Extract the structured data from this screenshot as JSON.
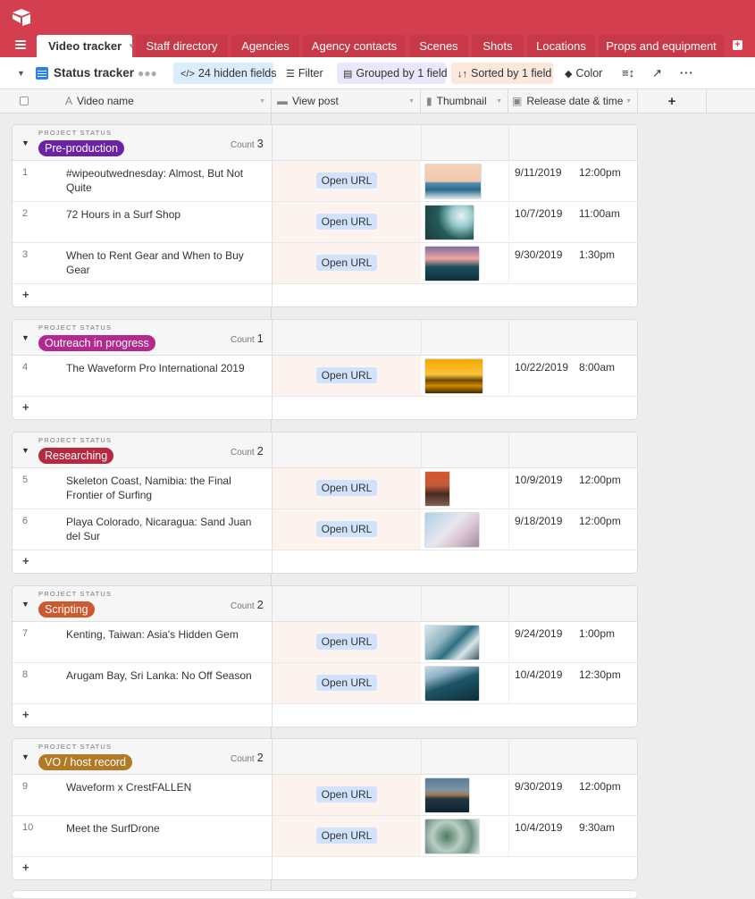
{
  "tabs": [
    {
      "label": "Video tracker",
      "active": true
    },
    {
      "label": "Staff directory"
    },
    {
      "label": "Agencies"
    },
    {
      "label": "Agency contacts"
    },
    {
      "label": "Scenes"
    },
    {
      "label": "Shots"
    },
    {
      "label": "Locations"
    },
    {
      "label": "Props and equipment"
    }
  ],
  "toolbar": {
    "view_name": "Status tracker",
    "hidden_fields": "24 hidden fields",
    "filter": "Filter",
    "grouped": "Grouped by 1 field",
    "sorted": "Sorted by 1 field",
    "color": "Color"
  },
  "columns": {
    "video_name": "Video name",
    "view_post": "View post",
    "thumbnail": "Thumbnail",
    "release": "Release date & time",
    "add": "+"
  },
  "group_label": "PROJECT STATUS",
  "count_label": "Count",
  "open_url_label": "Open URL",
  "groups": [
    {
      "status": "Pre-production",
      "color": "#6b21a8",
      "count": "3",
      "rows": [
        {
          "num": "1",
          "name": "#wipeoutwednesday: Almost, But Not Quite",
          "date": "9/11/2019",
          "time": "12:00pm",
          "thumb": "linear-gradient(180deg,#f6d2b8 0%,#f0c7ad 50%,#4f8fb0 55%,#2c6a8c 75%,#d7e2e8 100%)",
          "tw": 64
        },
        {
          "num": "2",
          "name": "72 Hours in a Surf Shop",
          "date": "10/7/2019",
          "time": "11:00am",
          "thumb": "radial-gradient(circle at 75% 30%,#e8f1f5 0%,#9cc 25%,#245a5a 55%,#1c3c3a 100%)",
          "tw": 56
        },
        {
          "num": "3",
          "name": "When to Rent Gear and When to Buy Gear",
          "date": "9/30/2019",
          "time": "1:30pm",
          "thumb": "linear-gradient(180deg,#7f6da0 0%,#f0a5a0 35%,#1b4f5e 60%,#0e2e36 100%)",
          "tw": 62
        }
      ]
    },
    {
      "status": "Outreach in progress",
      "color": "#b5298e",
      "count": "1",
      "rows": [
        {
          "num": "4",
          "name": "The Waveform Pro International 2019",
          "date": "10/22/2019",
          "time": "8:00am",
          "thumb": "linear-gradient(180deg,#f6a800 0%,#f9c23a 45%,#6a4a0a 62%,#d38a00 78%,#3a2a05 100%)",
          "tw": 66
        }
      ]
    },
    {
      "status": "Researching",
      "color": "#b7293f",
      "count": "2",
      "rows": [
        {
          "num": "5",
          "name": "Skeleton Coast, Namibia: the Final Frontier of Surfing",
          "date": "10/9/2019",
          "time": "12:00pm",
          "thumb": "linear-gradient(180deg,#d5582a 0%,#c35a3a 40%,#4a2a20 65%,#806050 100%)",
          "tw": 29
        },
        {
          "num": "6",
          "name": "Playa Colorado, Nicaragua: Sand Juan del Sur",
          "date": "9/18/2019",
          "time": "12:00pm",
          "thumb": "linear-gradient(135deg,#a9d3e4 0%,#e9e6ee 45%,#d7c1cf 70%,#9f8aa3 100%)",
          "tw": 62
        }
      ]
    },
    {
      "status": "Scripting",
      "color": "#cc5a2e",
      "count": "2",
      "rows": [
        {
          "num": "7",
          "name": "Kenting, Taiwan: Asia's Hidden Gem",
          "date": "9/24/2019",
          "time": "1:00pm",
          "thumb": "linear-gradient(135deg,#dfe8ec 0%,#8fb5c2 35%,#2b6f80 55%,#d9e4e8 75%,#3a5a66 100%)",
          "tw": 62
        },
        {
          "num": "8",
          "name": "Arugam Bay, Sri Lanka: No Off Season",
          "date": "10/4/2019",
          "time": "12:30pm",
          "thumb": "linear-gradient(160deg,#c9dbe6 0%,#8fb1c6 25%,#1d5566 50%,#0d2e38 100%)",
          "tw": 62
        }
      ]
    },
    {
      "status": "VO / host record",
      "color": "#b27a27",
      "count": "2",
      "rows": [
        {
          "num": "9",
          "name": "Waveform x CrestFALLEN",
          "date": "9/30/2019",
          "time": "12:00pm",
          "thumb": "linear-gradient(180deg,#5b7a96 0%,#7d94a6 35%,#a57a52 48%,#223646 60%,#10222e 100%)",
          "tw": 51
        },
        {
          "num": "10",
          "name": "Meet the SurfDrone",
          "date": "10/4/2019",
          "time": "9:30am",
          "thumb": "radial-gradient(circle at 40% 50%,#4f7a62 0%,#b9cdc4 40%,#6f9282 70%,#dfe8e4 100%)",
          "tw": 62
        }
      ]
    }
  ]
}
